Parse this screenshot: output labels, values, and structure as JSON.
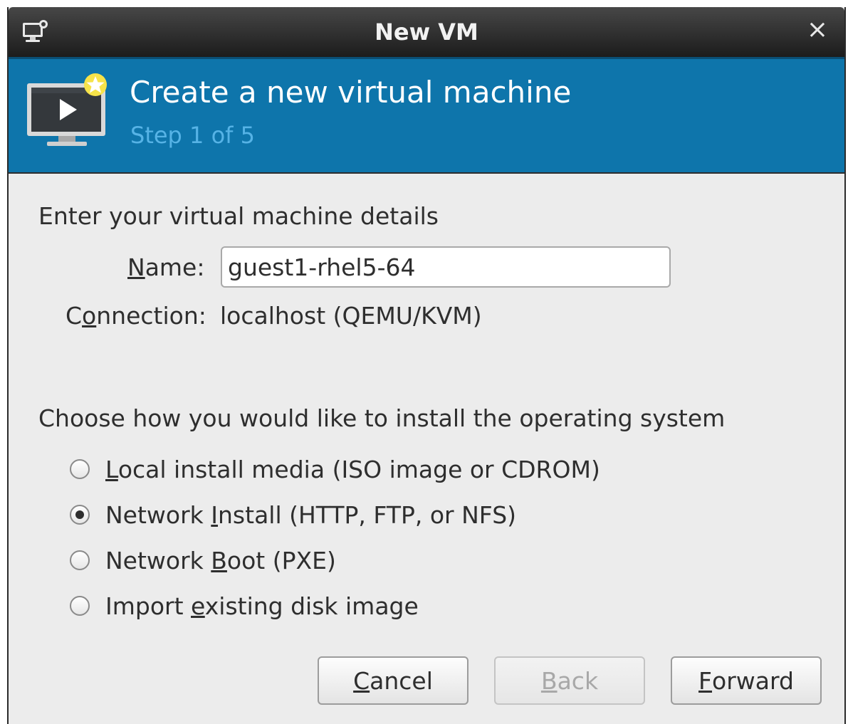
{
  "window": {
    "title": "New VM",
    "close_glyph": "×"
  },
  "banner": {
    "heading": "Create a new virtual machine",
    "step": "Step 1 of 5"
  },
  "details": {
    "section_label": "Enter your virtual machine details",
    "name_label": {
      "prefix": "",
      "key": "N",
      "suffix": "ame:"
    },
    "name_value": "guest1-rhel5-64",
    "connection_label": {
      "prefix": "C",
      "key": "o",
      "suffix": "nnection:"
    },
    "connection_value": "localhost (QEMU/KVM)"
  },
  "install": {
    "section_label": "Choose how you would like to install the operating system",
    "options": [
      {
        "prefix": "",
        "key": "L",
        "suffix": "ocal install media (ISO image or CDROM)",
        "selected": false
      },
      {
        "prefix": "Network ",
        "key": "I",
        "suffix": "nstall (HTTP, FTP, or NFS)",
        "selected": true
      },
      {
        "prefix": "Network ",
        "key": "B",
        "suffix": "oot (PXE)",
        "selected": false
      },
      {
        "prefix": "Import ",
        "key": "e",
        "suffix": "xisting disk image",
        "selected": false
      }
    ]
  },
  "buttons": {
    "cancel": {
      "prefix": "",
      "key": "C",
      "suffix": "ancel",
      "enabled": true
    },
    "back": {
      "prefix": "",
      "key": "B",
      "suffix": "ack",
      "enabled": false
    },
    "forward": {
      "prefix": "",
      "key": "F",
      "suffix": "orward",
      "enabled": true
    }
  },
  "icons": {
    "window_icon": "computer-monitor-icon",
    "banner_icon": "new-vm-monitor-icon",
    "close_icon": "close-icon"
  },
  "colors": {
    "banner_bg": "#0e75ab",
    "step_text": "#56b3e6",
    "titlebar": "#1c1c1c"
  }
}
